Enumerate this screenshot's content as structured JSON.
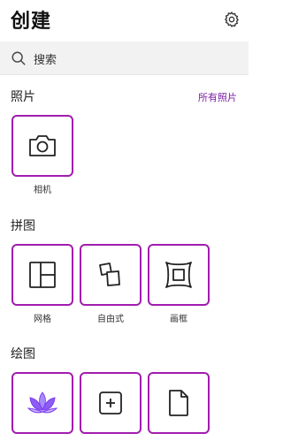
{
  "header": {
    "title": "创建",
    "settings_icon": "gear-icon"
  },
  "search": {
    "placeholder": "搜索",
    "icon": "search-icon"
  },
  "sections": [
    {
      "title": "照片",
      "link": "所有照片",
      "items": [
        {
          "label": "相机",
          "icon": "camera-icon"
        }
      ]
    },
    {
      "title": "拼图",
      "items": [
        {
          "label": "网格",
          "icon": "grid-layout-icon"
        },
        {
          "label": "自由式",
          "icon": "freeform-icon"
        },
        {
          "label": "画框",
          "icon": "frame-icon"
        }
      ]
    },
    {
      "title": "绘图",
      "items": [
        {
          "label": "",
          "icon": "lotus-icon"
        },
        {
          "label": "",
          "icon": "add-square-icon"
        },
        {
          "label": "",
          "icon": "blank-page-icon"
        }
      ]
    }
  ],
  "colors": {
    "accent": "#a21caf",
    "link": "#7b1fa2",
    "search_bg": "#f2f2f2",
    "lotus": "#8b5cf6"
  }
}
